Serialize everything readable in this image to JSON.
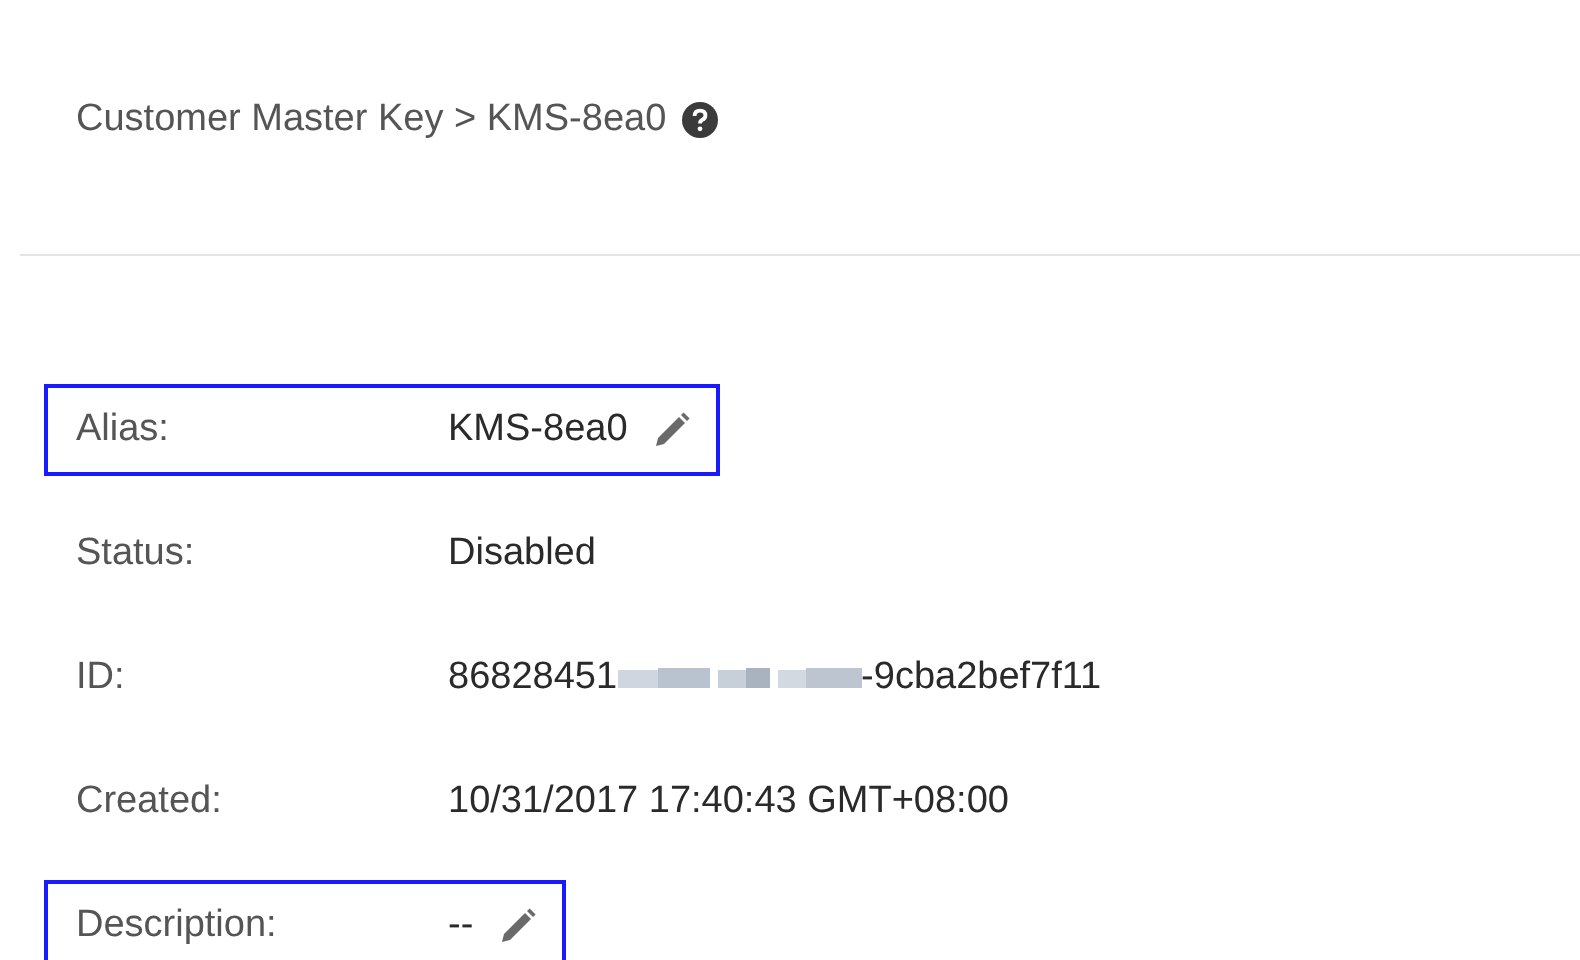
{
  "breadcrumb": {
    "text": "Customer Master Key > KMS-8ea0"
  },
  "fields": [
    {
      "kind": "text",
      "label": "Alias:",
      "value": "KMS-8ea0",
      "editable": true,
      "highlighted": true
    },
    {
      "kind": "text",
      "label": "Status:",
      "value": "Disabled",
      "editable": false,
      "highlighted": false
    },
    {
      "kind": "redacted",
      "label": "ID:",
      "value": "86828451",
      "value_end": "-9cba2bef7f11",
      "editable": false,
      "highlighted": false
    },
    {
      "kind": "text",
      "label": "Created:",
      "value": "10/31/2017 17:40:43 GMT+08:00",
      "editable": false,
      "highlighted": false
    },
    {
      "kind": "text",
      "label": "Description:",
      "value": "--",
      "editable": true,
      "highlighted": true
    }
  ]
}
